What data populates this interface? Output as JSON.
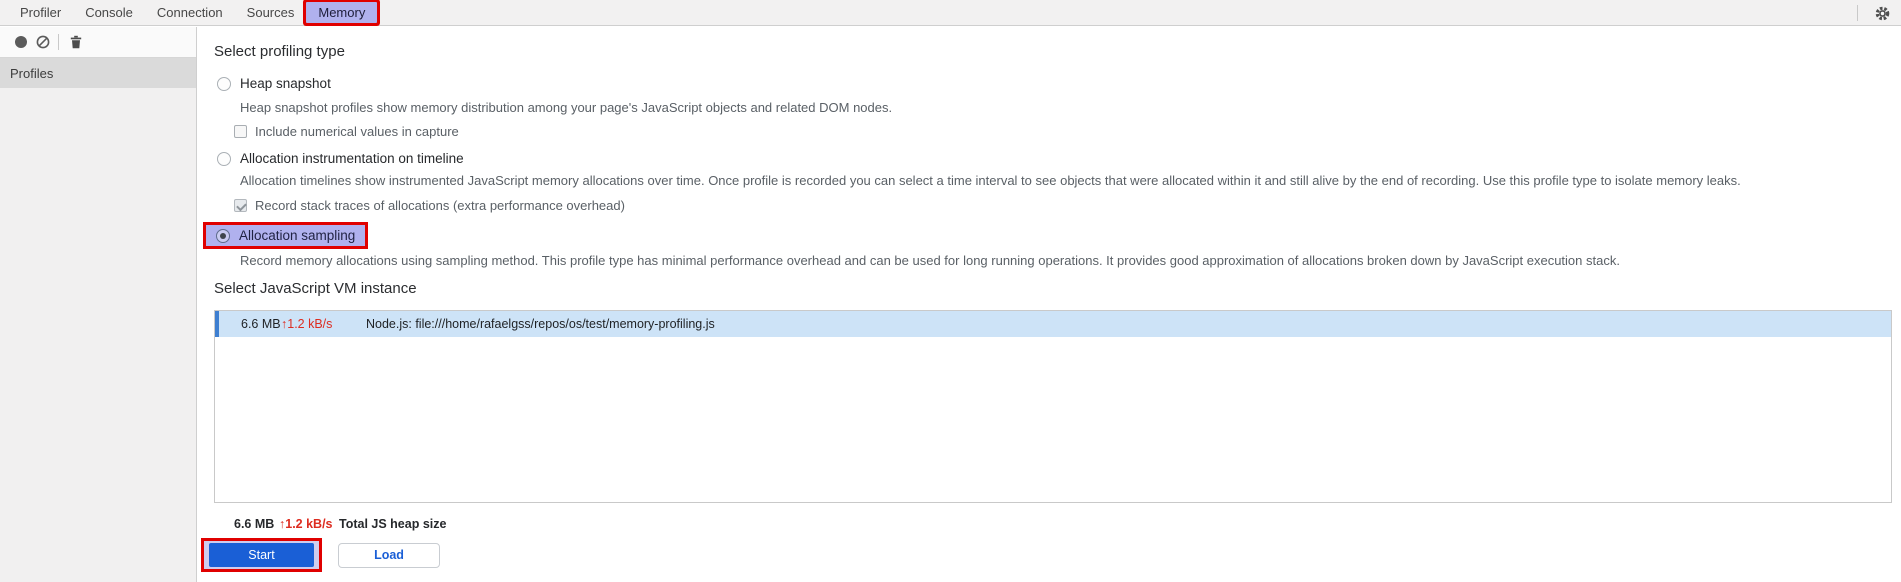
{
  "tabs": {
    "items": [
      {
        "label": "Profiler",
        "selected": false
      },
      {
        "label": "Console",
        "selected": false
      },
      {
        "label": "Connection",
        "selected": false
      },
      {
        "label": "Sources",
        "selected": false
      },
      {
        "label": "Memory",
        "selected": true,
        "annotated": true
      }
    ]
  },
  "toolbar": {
    "icons": [
      "record-icon",
      "clear-icon",
      "delete-icon"
    ]
  },
  "sidebar": {
    "header": "Profiles"
  },
  "icons": {
    "gear": "gear-icon",
    "record": "record-icon",
    "clear": "clear-icon",
    "delete": "delete-icon",
    "up_arrow": "↑"
  },
  "profiling": {
    "heading": "Select profiling type",
    "options": [
      {
        "label": "Heap snapshot",
        "selected": false,
        "description": "Heap snapshot profiles show memory distribution among your page's JavaScript objects and related DOM nodes.",
        "sub_checkbox": {
          "label": "Include numerical values in capture",
          "checked": false
        }
      },
      {
        "label": "Allocation instrumentation on timeline",
        "selected": false,
        "description": "Allocation timelines show instrumented JavaScript memory allocations over time. Once profile is recorded you can select a time interval to see objects that were allocated within it and still alive by the end of recording. Use this profile type to isolate memory leaks.",
        "sub_checkbox": {
          "label": "Record stack traces of allocations (extra performance overhead)",
          "checked": true
        }
      },
      {
        "label": "Allocation sampling",
        "selected": true,
        "annotated": true,
        "description": "Record memory allocations using sampling method. This profile type has minimal performance overhead and can be used for long running operations. It provides good approximation of allocations broken down by JavaScript execution stack."
      }
    ]
  },
  "vm": {
    "heading": "Select JavaScript VM instance",
    "instances": [
      {
        "size": "6.6 MB",
        "rate": "↑1.2 kB/s",
        "name": "Node.js: file:///home/rafaelgss/repos/os/test/memory-profiling.js",
        "selected": true
      }
    ],
    "total": {
      "size": "6.6 MB",
      "rate": "↑1.2 kB/s",
      "label": "Total JS heap size"
    }
  },
  "actions": {
    "start": "Start",
    "load": "Load"
  },
  "annotations": {
    "highlighted": [
      "tab-memory",
      "allocation-sampling-option",
      "start-button"
    ],
    "color": "#e00000",
    "fill": "#b0b1ee"
  },
  "colors": {
    "accent_blue": "#1a5fd6",
    "selected_row_bg": "#cde3f7",
    "selected_row_stripe": "#3e7fd1",
    "stat_red": "#dd2c20",
    "annotation_red": "#e00000",
    "annotation_lavender": "#b0b1ee"
  }
}
